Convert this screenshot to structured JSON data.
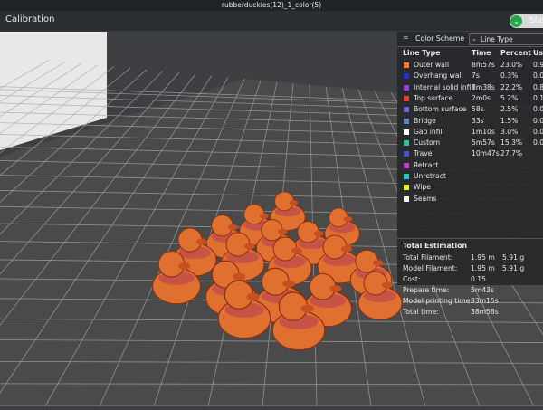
{
  "window": {
    "title": "rubberduckies(12)_1_color(5)"
  },
  "toolbar": {
    "page_title": "Calibration",
    "slice_label": "Slic"
  },
  "panel": {
    "color_scheme_label": "Color Scheme",
    "color_scheme_value": "Line Type",
    "headers": {
      "line_type": "Line Type",
      "time": "Time",
      "percent": "Percent",
      "usage": "Us"
    },
    "rows": [
      {
        "name": "Outer wall",
        "time": "8m57s",
        "percent": "23.0%",
        "usage": "0.9",
        "color": "#ff7f27"
      },
      {
        "name": "Overhang wall",
        "time": "7s",
        "percent": "0.3%",
        "usage": "0.0",
        "color": "#1e32d2"
      },
      {
        "name": "Internal solid infill",
        "time": "8m38s",
        "percent": "22.2%",
        "usage": "0.8",
        "color": "#9b3ce6"
      },
      {
        "name": "Top surface",
        "time": "2m0s",
        "percent": "5.2%",
        "usage": "0.1",
        "color": "#f03c3c"
      },
      {
        "name": "Bottom surface",
        "time": "58s",
        "percent": "2.5%",
        "usage": "0.0",
        "color": "#6e66d6"
      },
      {
        "name": "Bridge",
        "time": "33s",
        "percent": "1.5%",
        "usage": "0.0",
        "color": "#5a86c8"
      },
      {
        "name": "Gap infill",
        "time": "1m10s",
        "percent": "3.0%",
        "usage": "0.0",
        "color": "#ffffff"
      },
      {
        "name": "Custom",
        "time": "5m57s",
        "percent": "15.3%",
        "usage": "0.0",
        "color": "#2ec4a0"
      },
      {
        "name": "Travel",
        "time": "10m47s",
        "percent": "27.7%",
        "usage": "",
        "color": "#5050d0"
      },
      {
        "name": "Retract",
        "time": "",
        "percent": "",
        "usage": "",
        "color": "#c83cd2"
      },
      {
        "name": "Unretract",
        "time": "",
        "percent": "",
        "usage": "",
        "color": "#20c8c8"
      },
      {
        "name": "Wipe",
        "time": "",
        "percent": "",
        "usage": "",
        "color": "#f0f028"
      },
      {
        "name": "Seams",
        "time": "",
        "percent": "",
        "usage": "",
        "color": "#f0f0f0"
      }
    ],
    "total_estimation": {
      "title": "Total Estimation",
      "items": [
        {
          "label": "Total Filament:",
          "value": "1.95 m",
          "value2": "5.91 g"
        },
        {
          "label": "Model Filament:",
          "value": "1.95 m",
          "value2": "5.91 g"
        },
        {
          "label": "Cost:",
          "value": "0.15",
          "value2": ""
        },
        {
          "label": "Prepare time:",
          "value": "5m43s",
          "value2": ""
        },
        {
          "label": "Model printing time:",
          "value": "33m15s",
          "value2": ""
        },
        {
          "label": "Total time:",
          "value": "38m58s",
          "value2": ""
        }
      ]
    }
  },
  "viewport": {
    "background_color": "#3d3e42",
    "bed_color": "#4a4a4a",
    "grid_color": "#b4b4b4",
    "model_color": "#e07030",
    "model_name": "rubber ducks"
  }
}
